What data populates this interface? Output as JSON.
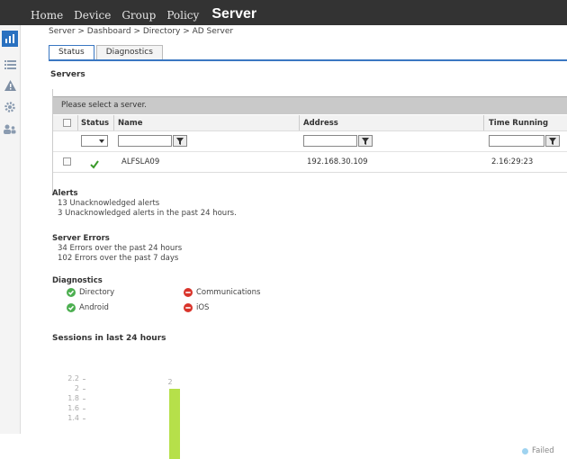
{
  "nav": {
    "items": [
      "Home",
      "Device",
      "Group",
      "Policy"
    ],
    "active": "Server"
  },
  "breadcrumb": "Server > Dashboard > Directory > AD Server",
  "tabs": {
    "status": "Status",
    "diagnostics": "Diagnostics"
  },
  "servers": {
    "title": "Servers",
    "prompt": "Please select a server.",
    "columns": {
      "status": "Status",
      "name": "Name",
      "address": "Address",
      "time_running": "Time Running"
    },
    "rows": [
      {
        "status_icon": "check-icon",
        "name": "ALFSLA09",
        "address": "192.168.30.109",
        "time_running": "2.16:29:23"
      }
    ]
  },
  "alerts": {
    "title": "Alerts",
    "lines": [
      "13 Unacknowledged alerts",
      "3 Unacknowledged alerts in the past 24 hours."
    ]
  },
  "server_errors": {
    "title": "Server Errors",
    "lines": [
      "34 Errors over the past 24 hours",
      "102 Errors over the past 7 days"
    ]
  },
  "diagnostics": {
    "title": "Diagnostics",
    "items": [
      {
        "label": "Directory",
        "status": "ok"
      },
      {
        "label": "Communications",
        "status": "error"
      },
      {
        "label": "Android",
        "status": "ok"
      },
      {
        "label": "iOS",
        "status": "error"
      }
    ]
  },
  "sessions": {
    "title": "Sessions in last 24 hours",
    "legend": "Failed",
    "legend_color": "#9fd3f0"
  },
  "chart_data": {
    "type": "bar",
    "categories": [
      ""
    ],
    "values": [
      2
    ],
    "bar_label": "2",
    "yticks": [
      "2.2",
      "2",
      "1.8",
      "1.6",
      "1.4"
    ],
    "ylim": [
      1.4,
      2.2
    ],
    "legend": [
      "Failed"
    ],
    "colors": {
      "bar": "#b6e04a",
      "failed": "#9fd3f0"
    }
  },
  "colors": {
    "ok": "#4caf50",
    "error": "#d9342b",
    "active_nav": "#2a71c0",
    "check": "#3a9a2a"
  }
}
